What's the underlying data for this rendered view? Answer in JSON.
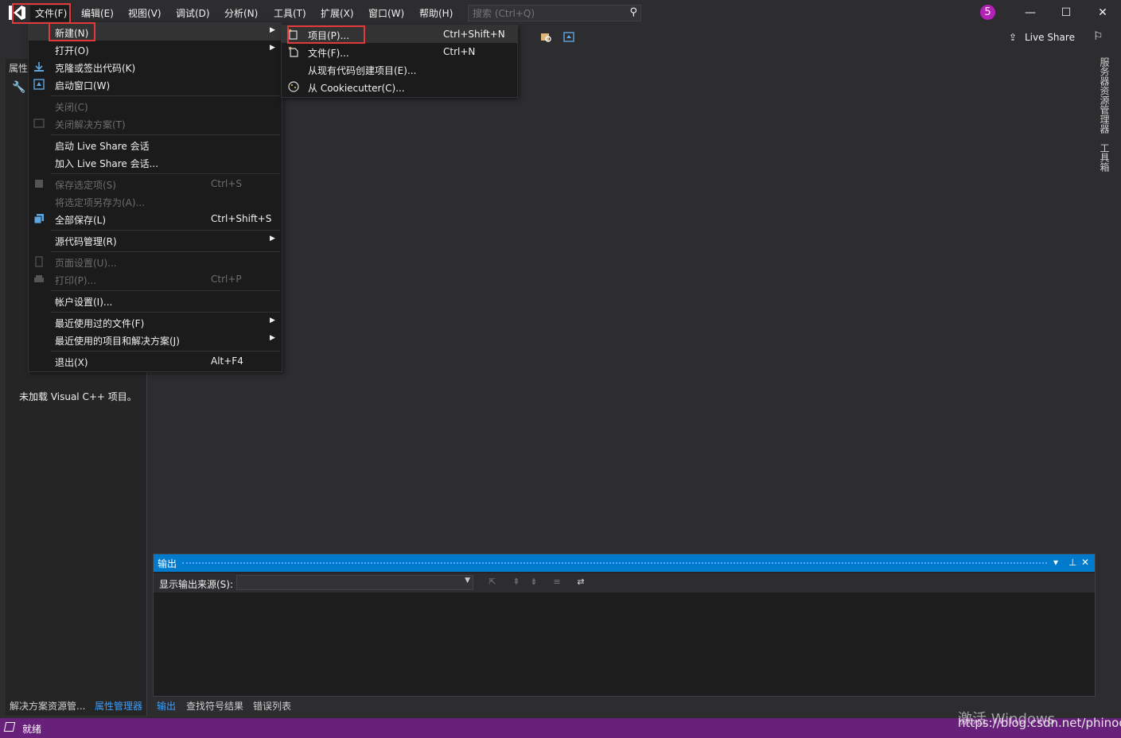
{
  "titlebar": {
    "menus": [
      "文件(F)",
      "编辑(E)",
      "视图(V)",
      "调试(D)",
      "分析(N)",
      "工具(T)",
      "扩展(X)",
      "窗口(W)",
      "帮助(H)"
    ],
    "search_placeholder": "搜索 (Ctrl+Q)",
    "notification_count": "5"
  },
  "toolbar": {
    "live_share": "Live Share"
  },
  "file_menu": {
    "items": [
      {
        "label": "新建(N)",
        "shortcut": "",
        "submenu": true
      },
      {
        "label": "打开(O)",
        "shortcut": "",
        "submenu": true
      },
      {
        "label": "克隆或签出代码(K)",
        "shortcut": ""
      },
      {
        "label": "启动窗口(W)",
        "shortcut": ""
      },
      {
        "label": "关闭(C)",
        "shortcut": "",
        "disabled": true
      },
      {
        "label": "关闭解决方案(T)",
        "shortcut": "",
        "disabled": true
      },
      {
        "label": "启动 Live Share 会话",
        "shortcut": ""
      },
      {
        "label": "加入 Live Share 会话...",
        "shortcut": ""
      },
      {
        "label": "保存选定项(S)",
        "shortcut": "Ctrl+S",
        "disabled": true
      },
      {
        "label": "将选定项另存为(A)...",
        "shortcut": "",
        "disabled": true
      },
      {
        "label": "全部保存(L)",
        "shortcut": "Ctrl+Shift+S"
      },
      {
        "label": "源代码管理(R)",
        "shortcut": "",
        "submenu": true
      },
      {
        "label": "页面设置(U)...",
        "shortcut": "",
        "disabled": true
      },
      {
        "label": "打印(P)...",
        "shortcut": "Ctrl+P",
        "disabled": true
      },
      {
        "label": "帐户设置(I)...",
        "shortcut": ""
      },
      {
        "label": "最近使用过的文件(F)",
        "shortcut": "",
        "submenu": true
      },
      {
        "label": "最近使用的项目和解决方案(J)",
        "shortcut": "",
        "submenu": true
      },
      {
        "label": "退出(X)",
        "shortcut": "Alt+F4"
      }
    ]
  },
  "new_submenu": {
    "items": [
      {
        "label": "项目(P)...",
        "shortcut": "Ctrl+Shift+N"
      },
      {
        "label": "文件(F)...",
        "shortcut": "Ctrl+N"
      },
      {
        "label": "从现有代码创建项目(E)...",
        "shortcut": ""
      },
      {
        "label": "从 Cookiecutter(C)...",
        "shortcut": ""
      }
    ]
  },
  "left_panel": {
    "title": "属性",
    "message": "未加载 Visual C++ 项目。",
    "tabs": [
      "解决方案资源管...",
      "属性管理器"
    ]
  },
  "right_strip": {
    "tabs": [
      "服务器资源管理器",
      "工具箱"
    ]
  },
  "output": {
    "title": "输出",
    "source_label": "显示输出来源(S):",
    "tabs": [
      "输出",
      "查找符号结果",
      "错误列表"
    ]
  },
  "status": {
    "text": "就绪",
    "watermark": "激活 Windows",
    "url": "https://blog.csdn.net/phinoo"
  }
}
